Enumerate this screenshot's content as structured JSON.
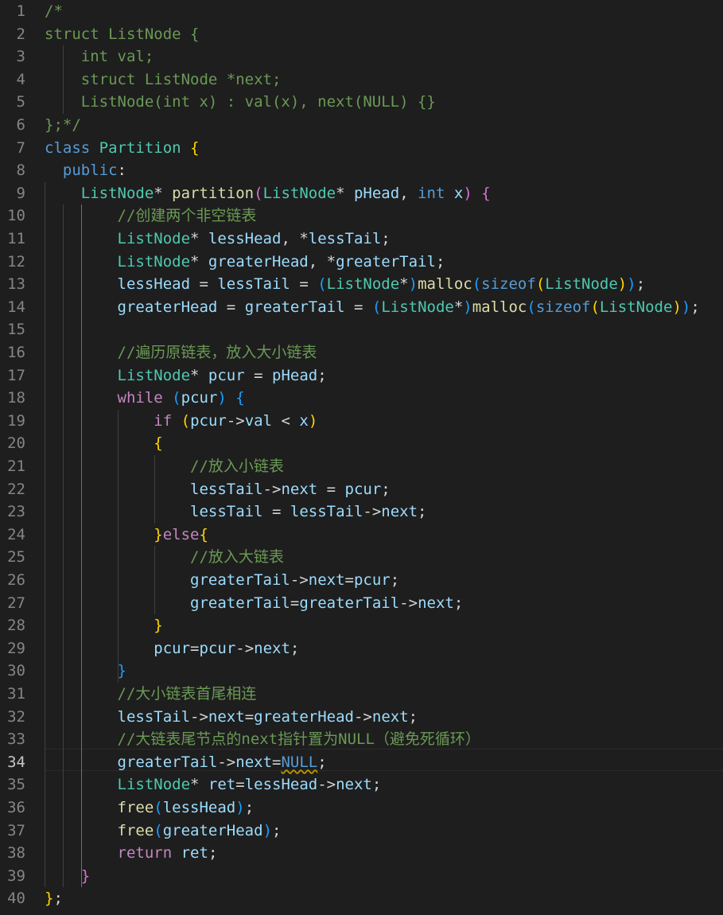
{
  "editor": {
    "language": "cpp",
    "active_line": 34,
    "lines": [
      {
        "n": "1",
        "tokens": [
          {
            "t": "/*",
            "c": "cm"
          }
        ]
      },
      {
        "n": "2",
        "tokens": [
          {
            "t": "struct ListNode {",
            "c": "cm"
          }
        ]
      },
      {
        "n": "3",
        "tokens": [
          {
            "t": "    int val;",
            "c": "cm"
          }
        ]
      },
      {
        "n": "4",
        "tokens": [
          {
            "t": "    struct ListNode *next;",
            "c": "cm"
          }
        ]
      },
      {
        "n": "5",
        "tokens": [
          {
            "t": "    ListNode(int x) : val(x), next(NULL) {}",
            "c": "cm"
          }
        ]
      },
      {
        "n": "6",
        "tokens": [
          {
            "t": "};*/",
            "c": "cm"
          }
        ]
      },
      {
        "n": "7",
        "tokens": [
          {
            "t": "class",
            "c": "kw"
          },
          {
            "t": " "
          },
          {
            "t": "Partition",
            "c": "ty"
          },
          {
            "t": " "
          },
          {
            "t": "{",
            "c": "b1"
          }
        ]
      },
      {
        "n": "8",
        "tokens": [
          {
            "t": "  "
          },
          {
            "t": "public",
            "c": "kw"
          },
          {
            "t": ":",
            "c": "op"
          }
        ]
      },
      {
        "n": "9",
        "tokens": [
          {
            "t": "    "
          },
          {
            "t": "ListNode",
            "c": "ty"
          },
          {
            "t": "* ",
            "c": "op"
          },
          {
            "t": "partition",
            "c": "fn"
          },
          {
            "t": "(",
            "c": "b2"
          },
          {
            "t": "ListNode",
            "c": "ty"
          },
          {
            "t": "* ",
            "c": "op"
          },
          {
            "t": "pHead",
            "c": "pa"
          },
          {
            "t": ", ",
            "c": "op"
          },
          {
            "t": "int",
            "c": "kw"
          },
          {
            "t": " "
          },
          {
            "t": "x",
            "c": "pa"
          },
          {
            "t": ")",
            "c": "b2"
          },
          {
            "t": " "
          },
          {
            "t": "{",
            "c": "b2"
          }
        ]
      },
      {
        "n": "10",
        "tokens": [
          {
            "t": "        "
          },
          {
            "t": "//创建两个非空链表",
            "c": "cm"
          }
        ]
      },
      {
        "n": "11",
        "tokens": [
          {
            "t": "        "
          },
          {
            "t": "ListNode",
            "c": "ty"
          },
          {
            "t": "* ",
            "c": "op"
          },
          {
            "t": "lessHead",
            "c": "pa"
          },
          {
            "t": ", *",
            "c": "op"
          },
          {
            "t": "lessTail",
            "c": "pa"
          },
          {
            "t": ";",
            "c": "op"
          }
        ]
      },
      {
        "n": "12",
        "tokens": [
          {
            "t": "        "
          },
          {
            "t": "ListNode",
            "c": "ty"
          },
          {
            "t": "* ",
            "c": "op"
          },
          {
            "t": "greaterHead",
            "c": "pa"
          },
          {
            "t": ", *",
            "c": "op"
          },
          {
            "t": "greaterTail",
            "c": "pa"
          },
          {
            "t": ";",
            "c": "op"
          }
        ]
      },
      {
        "n": "13",
        "tokens": [
          {
            "t": "        "
          },
          {
            "t": "lessHead",
            "c": "pa"
          },
          {
            "t": " = ",
            "c": "op"
          },
          {
            "t": "lessTail",
            "c": "pa"
          },
          {
            "t": " = ",
            "c": "op"
          },
          {
            "t": "(",
            "c": "b3"
          },
          {
            "t": "ListNode",
            "c": "ty"
          },
          {
            "t": "*",
            "c": "op"
          },
          {
            "t": ")",
            "c": "b3"
          },
          {
            "t": "malloc",
            "c": "fn"
          },
          {
            "t": "(",
            "c": "b3"
          },
          {
            "t": "sizeof",
            "c": "kw"
          },
          {
            "t": "(",
            "c": "b1"
          },
          {
            "t": "ListNode",
            "c": "ty"
          },
          {
            "t": ")",
            "c": "b1"
          },
          {
            "t": ")",
            "c": "b3"
          },
          {
            "t": ";",
            "c": "op"
          }
        ]
      },
      {
        "n": "14",
        "tokens": [
          {
            "t": "        "
          },
          {
            "t": "greaterHead",
            "c": "pa"
          },
          {
            "t": " = ",
            "c": "op"
          },
          {
            "t": "greaterTail",
            "c": "pa"
          },
          {
            "t": " = ",
            "c": "op"
          },
          {
            "t": "(",
            "c": "b3"
          },
          {
            "t": "ListNode",
            "c": "ty"
          },
          {
            "t": "*",
            "c": "op"
          },
          {
            "t": ")",
            "c": "b3"
          },
          {
            "t": "malloc",
            "c": "fn"
          },
          {
            "t": "(",
            "c": "b3"
          },
          {
            "t": "sizeof",
            "c": "kw"
          },
          {
            "t": "(",
            "c": "b1"
          },
          {
            "t": "ListNode",
            "c": "ty"
          },
          {
            "t": ")",
            "c": "b1"
          },
          {
            "t": ")",
            "c": "b3"
          },
          {
            "t": ";",
            "c": "op"
          }
        ]
      },
      {
        "n": "15",
        "tokens": []
      },
      {
        "n": "16",
        "tokens": [
          {
            "t": "        "
          },
          {
            "t": "//遍历原链表，放入大小链表",
            "c": "cm"
          }
        ]
      },
      {
        "n": "17",
        "tokens": [
          {
            "t": "        "
          },
          {
            "t": "ListNode",
            "c": "ty"
          },
          {
            "t": "* ",
            "c": "op"
          },
          {
            "t": "pcur",
            "c": "pa"
          },
          {
            "t": " = ",
            "c": "op"
          },
          {
            "t": "pHead",
            "c": "pa"
          },
          {
            "t": ";",
            "c": "op"
          }
        ]
      },
      {
        "n": "18",
        "tokens": [
          {
            "t": "        "
          },
          {
            "t": "while",
            "c": "ctl"
          },
          {
            "t": " "
          },
          {
            "t": "(",
            "c": "b3"
          },
          {
            "t": "pcur",
            "c": "pa"
          },
          {
            "t": ")",
            "c": "b3"
          },
          {
            "t": " "
          },
          {
            "t": "{",
            "c": "b3"
          }
        ]
      },
      {
        "n": "19",
        "tokens": [
          {
            "t": "            "
          },
          {
            "t": "if",
            "c": "ctl"
          },
          {
            "t": " "
          },
          {
            "t": "(",
            "c": "b1"
          },
          {
            "t": "pcur",
            "c": "pa"
          },
          {
            "t": "->",
            "c": "op"
          },
          {
            "t": "val",
            "c": "pa"
          },
          {
            "t": " < ",
            "c": "op"
          },
          {
            "t": "x",
            "c": "pa"
          },
          {
            "t": ")",
            "c": "b1"
          }
        ]
      },
      {
        "n": "20",
        "tokens": [
          {
            "t": "            "
          },
          {
            "t": "{",
            "c": "b1"
          }
        ]
      },
      {
        "n": "21",
        "tokens": [
          {
            "t": "                "
          },
          {
            "t": "//放入小链表",
            "c": "cm"
          }
        ]
      },
      {
        "n": "22",
        "tokens": [
          {
            "t": "                "
          },
          {
            "t": "lessTail",
            "c": "pa"
          },
          {
            "t": "->",
            "c": "op"
          },
          {
            "t": "next",
            "c": "pa"
          },
          {
            "t": " = ",
            "c": "op"
          },
          {
            "t": "pcur",
            "c": "pa"
          },
          {
            "t": ";",
            "c": "op"
          }
        ]
      },
      {
        "n": "23",
        "tokens": [
          {
            "t": "                "
          },
          {
            "t": "lessTail",
            "c": "pa"
          },
          {
            "t": " = ",
            "c": "op"
          },
          {
            "t": "lessTail",
            "c": "pa"
          },
          {
            "t": "->",
            "c": "op"
          },
          {
            "t": "next",
            "c": "pa"
          },
          {
            "t": ";",
            "c": "op"
          }
        ]
      },
      {
        "n": "24",
        "tokens": [
          {
            "t": "            "
          },
          {
            "t": "}",
            "c": "b1"
          },
          {
            "t": "else",
            "c": "ctl"
          },
          {
            "t": "{",
            "c": "b1"
          }
        ]
      },
      {
        "n": "25",
        "tokens": [
          {
            "t": "                "
          },
          {
            "t": "//放入大链表",
            "c": "cm"
          }
        ]
      },
      {
        "n": "26",
        "tokens": [
          {
            "t": "                "
          },
          {
            "t": "greaterTail",
            "c": "pa"
          },
          {
            "t": "->",
            "c": "op"
          },
          {
            "t": "next",
            "c": "pa"
          },
          {
            "t": "=",
            "c": "op"
          },
          {
            "t": "pcur",
            "c": "pa"
          },
          {
            "t": ";",
            "c": "op"
          }
        ]
      },
      {
        "n": "27",
        "tokens": [
          {
            "t": "                "
          },
          {
            "t": "greaterTail",
            "c": "pa"
          },
          {
            "t": "=",
            "c": "op"
          },
          {
            "t": "greaterTail",
            "c": "pa"
          },
          {
            "t": "->",
            "c": "op"
          },
          {
            "t": "next",
            "c": "pa"
          },
          {
            "t": ";",
            "c": "op"
          }
        ]
      },
      {
        "n": "28",
        "tokens": [
          {
            "t": "            "
          },
          {
            "t": "}",
            "c": "b1"
          }
        ]
      },
      {
        "n": "29",
        "tokens": [
          {
            "t": "            "
          },
          {
            "t": "pcur",
            "c": "pa"
          },
          {
            "t": "=",
            "c": "op"
          },
          {
            "t": "pcur",
            "c": "pa"
          },
          {
            "t": "->",
            "c": "op"
          },
          {
            "t": "next",
            "c": "pa"
          },
          {
            "t": ";",
            "c": "op"
          }
        ]
      },
      {
        "n": "30",
        "tokens": [
          {
            "t": "        "
          },
          {
            "t": "}",
            "c": "b3"
          }
        ]
      },
      {
        "n": "31",
        "tokens": [
          {
            "t": "        "
          },
          {
            "t": "//大小链表首尾相连",
            "c": "cm"
          }
        ]
      },
      {
        "n": "32",
        "tokens": [
          {
            "t": "        "
          },
          {
            "t": "lessTail",
            "c": "pa"
          },
          {
            "t": "->",
            "c": "op"
          },
          {
            "t": "next",
            "c": "pa"
          },
          {
            "t": "=",
            "c": "op"
          },
          {
            "t": "greaterHead",
            "c": "pa"
          },
          {
            "t": "->",
            "c": "op"
          },
          {
            "t": "next",
            "c": "pa"
          },
          {
            "t": ";",
            "c": "op"
          }
        ]
      },
      {
        "n": "33",
        "tokens": [
          {
            "t": "        "
          },
          {
            "t": "//大链表尾节点的next指针置为NULL（避免死循环）",
            "c": "cm"
          }
        ]
      },
      {
        "n": "34",
        "tokens": [
          {
            "t": "        "
          },
          {
            "t": "greaterTail",
            "c": "pa"
          },
          {
            "t": "->",
            "c": "op"
          },
          {
            "t": "next",
            "c": "pa"
          },
          {
            "t": "=",
            "c": "op"
          },
          {
            "t": "NULL",
            "c": "kw",
            "squiggle": true
          },
          {
            "t": ";",
            "c": "op"
          }
        ]
      },
      {
        "n": "35",
        "tokens": [
          {
            "t": "        "
          },
          {
            "t": "ListNode",
            "c": "ty"
          },
          {
            "t": "* ",
            "c": "op"
          },
          {
            "t": "ret",
            "c": "pa"
          },
          {
            "t": "=",
            "c": "op"
          },
          {
            "t": "lessHead",
            "c": "pa"
          },
          {
            "t": "->",
            "c": "op"
          },
          {
            "t": "next",
            "c": "pa"
          },
          {
            "t": ";",
            "c": "op"
          }
        ]
      },
      {
        "n": "36",
        "tokens": [
          {
            "t": "        "
          },
          {
            "t": "free",
            "c": "fn"
          },
          {
            "t": "(",
            "c": "b3"
          },
          {
            "t": "lessHead",
            "c": "pa"
          },
          {
            "t": ")",
            "c": "b3"
          },
          {
            "t": ";",
            "c": "op"
          }
        ]
      },
      {
        "n": "37",
        "tokens": [
          {
            "t": "        "
          },
          {
            "t": "free",
            "c": "fn"
          },
          {
            "t": "(",
            "c": "b3"
          },
          {
            "t": "greaterHead",
            "c": "pa"
          },
          {
            "t": ")",
            "c": "b3"
          },
          {
            "t": ";",
            "c": "op"
          }
        ]
      },
      {
        "n": "38",
        "tokens": [
          {
            "t": "        "
          },
          {
            "t": "return",
            "c": "ctl"
          },
          {
            "t": " "
          },
          {
            "t": "ret",
            "c": "pa"
          },
          {
            "t": ";",
            "c": "op"
          }
        ]
      },
      {
        "n": "39",
        "tokens": [
          {
            "t": "    "
          },
          {
            "t": "}",
            "c": "b2"
          }
        ]
      },
      {
        "n": "40",
        "tokens": [
          {
            "t": "}",
            "c": "b1"
          },
          {
            "t": ";",
            "c": "op"
          }
        ]
      }
    ]
  }
}
